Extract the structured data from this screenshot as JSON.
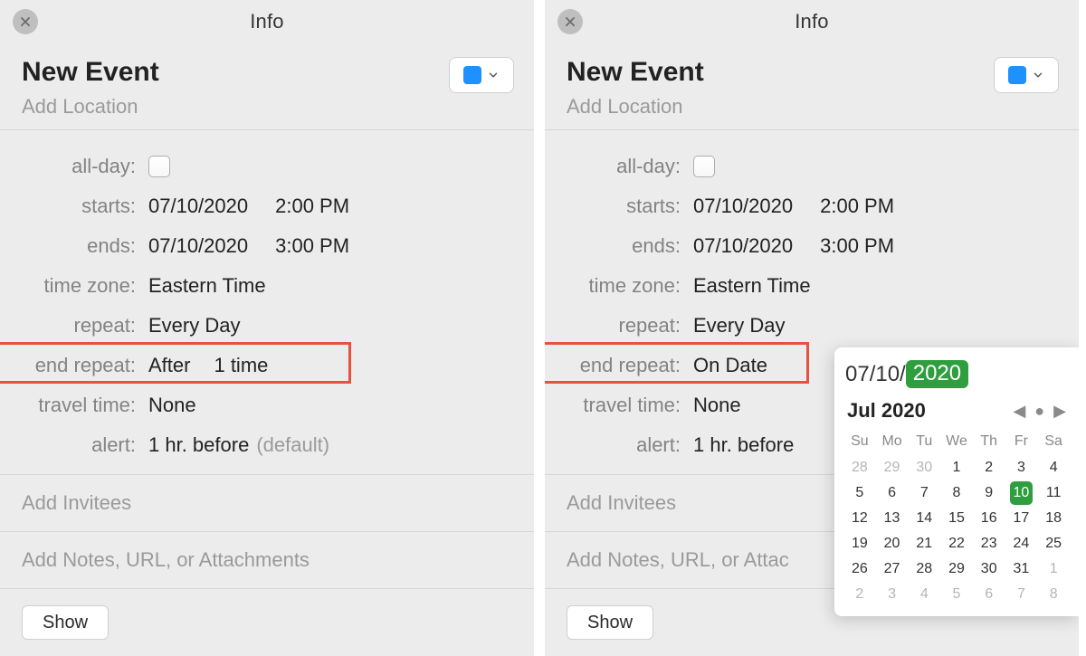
{
  "left": {
    "header": "Info",
    "title": "New Event",
    "location_placeholder": "Add Location",
    "labels": {
      "all_day": "all-day:",
      "starts": "starts:",
      "ends": "ends:",
      "tz": "time zone:",
      "repeat": "repeat:",
      "end_repeat": "end repeat:",
      "travel": "travel time:",
      "alert": "alert:"
    },
    "values": {
      "starts_date": "07/10/2020",
      "starts_time": "2:00 PM",
      "ends_date": "07/10/2020",
      "ends_time": "3:00 PM",
      "tz": "Eastern Time",
      "repeat": "Every Day",
      "end_repeat_mode": "After",
      "end_repeat_count": "1 time",
      "travel": "None",
      "alert_main": "1 hr. before",
      "alert_suffix": "(default)"
    },
    "invitees_placeholder": "Add Invitees",
    "notes_placeholder": "Add Notes, URL, or Attachments",
    "show_button": "Show"
  },
  "right": {
    "header": "Info",
    "title": "New Event",
    "location_placeholder": "Add Location",
    "labels": {
      "all_day": "all-day:",
      "starts": "starts:",
      "ends": "ends:",
      "tz": "time zone:",
      "repeat": "repeat:",
      "end_repeat": "end repeat:",
      "travel": "travel time:",
      "alert": "alert:"
    },
    "values": {
      "starts_date": "07/10/2020",
      "starts_time": "2:00 PM",
      "ends_date": "07/10/2020",
      "ends_time": "3:00 PM",
      "tz": "Eastern Time",
      "repeat": "Every Day",
      "end_repeat_mode": "On Date",
      "travel": "None",
      "alert_main": "1 hr. before"
    },
    "invitees_placeholder": "Add Invitees",
    "notes_placeholder": "Add Notes, URL, or Attac",
    "show_button": "Show",
    "datepicker": {
      "input_prefix": "07/10/",
      "input_year": "2020",
      "month_label": "Jul 2020",
      "dow": [
        "Su",
        "Mo",
        "Tu",
        "We",
        "Th",
        "Fr",
        "Sa"
      ],
      "weeks": [
        [
          {
            "n": "28",
            "off": true
          },
          {
            "n": "29",
            "off": true
          },
          {
            "n": "30",
            "off": true
          },
          {
            "n": "1"
          },
          {
            "n": "2"
          },
          {
            "n": "3"
          },
          {
            "n": "4"
          }
        ],
        [
          {
            "n": "5"
          },
          {
            "n": "6"
          },
          {
            "n": "7"
          },
          {
            "n": "8"
          },
          {
            "n": "9"
          },
          {
            "n": "10",
            "sel": true
          },
          {
            "n": "11"
          }
        ],
        [
          {
            "n": "12"
          },
          {
            "n": "13"
          },
          {
            "n": "14"
          },
          {
            "n": "15"
          },
          {
            "n": "16"
          },
          {
            "n": "17"
          },
          {
            "n": "18"
          }
        ],
        [
          {
            "n": "19"
          },
          {
            "n": "20"
          },
          {
            "n": "21"
          },
          {
            "n": "22"
          },
          {
            "n": "23"
          },
          {
            "n": "24"
          },
          {
            "n": "25"
          }
        ],
        [
          {
            "n": "26"
          },
          {
            "n": "27"
          },
          {
            "n": "28"
          },
          {
            "n": "29"
          },
          {
            "n": "30"
          },
          {
            "n": "31"
          },
          {
            "n": "1",
            "off": true
          }
        ],
        [
          {
            "n": "2",
            "off": true
          },
          {
            "n": "3",
            "off": true
          },
          {
            "n": "4",
            "off": true
          },
          {
            "n": "5",
            "off": true
          },
          {
            "n": "6",
            "off": true
          },
          {
            "n": "7",
            "off": true
          },
          {
            "n": "8",
            "off": true
          }
        ]
      ]
    }
  }
}
